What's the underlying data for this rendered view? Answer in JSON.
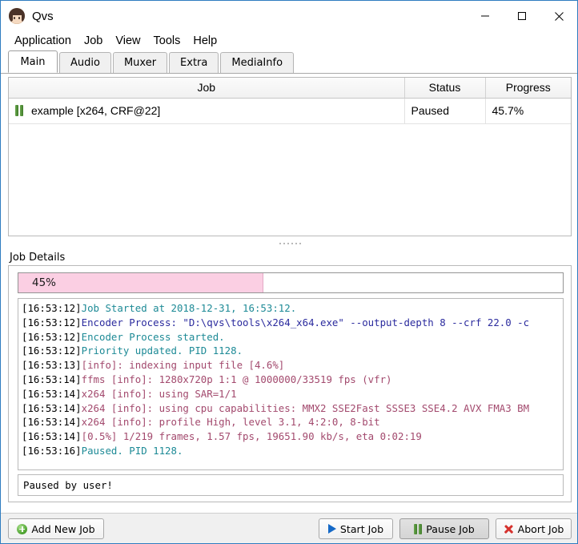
{
  "window": {
    "title": "Qvs",
    "icon": "app-avatar-icon",
    "controls": [
      {
        "name": "minimize",
        "glyph": "minimize-icon"
      },
      {
        "name": "maximize",
        "glyph": "maximize-icon"
      },
      {
        "name": "close",
        "glyph": "close-icon"
      }
    ]
  },
  "menu": {
    "items": [
      {
        "label": "Application"
      },
      {
        "label": "Job"
      },
      {
        "label": "View"
      },
      {
        "label": "Tools"
      },
      {
        "label": "Help"
      }
    ]
  },
  "tabs": {
    "active": "Main",
    "items": [
      {
        "label": "Main"
      },
      {
        "label": "Audio"
      },
      {
        "label": "Muxer"
      },
      {
        "label": "Extra"
      },
      {
        "label": "MediaInfo"
      }
    ]
  },
  "jobs_table": {
    "columns": [
      "Job",
      "Status",
      "Progress"
    ],
    "rows": [
      {
        "icon": "pause-icon",
        "job": "example [x264, CRF@22]",
        "status": "Paused",
        "progress": "45.7%"
      }
    ]
  },
  "details": {
    "group_label": "Job Details",
    "progress": {
      "percent_text": "45%",
      "percent_value": 45,
      "fill_color": "#fbcfe3"
    },
    "log": [
      {
        "time": "[16:53:12]",
        "text": "Job Started at 2018-12-31, 16:53:12.",
        "color": "teal"
      },
      {
        "time": "[16:53:12]",
        "text": "Encoder Process: \"D:\\qvs\\tools\\x264_x64.exe\" --output-depth 8 --crf 22.0 -c",
        "color": "navy"
      },
      {
        "time": "[16:53:12]",
        "text": "Encoder Process started.",
        "color": "teal"
      },
      {
        "time": "[16:53:12]",
        "text": "Priority updated. PID 1128.",
        "color": "teal"
      },
      {
        "time": "[16:53:13]",
        "text": "[info]: indexing input file [4.6%]",
        "color": "rose"
      },
      {
        "time": "[16:53:14]",
        "text": "ffms [info]: 1280x720p 1:1 @ 1000000/33519 fps (vfr)",
        "color": "rose"
      },
      {
        "time": "[16:53:14]",
        "text": "x264 [info]: using SAR=1/1",
        "color": "rose"
      },
      {
        "time": "[16:53:14]",
        "text": "x264 [info]: using cpu capabilities: MMX2 SSE2Fast SSSE3 SSE4.2 AVX FMA3 BM",
        "color": "rose"
      },
      {
        "time": "[16:53:14]",
        "text": "x264 [info]: profile High, level 3.1, 4:2:0, 8-bit",
        "color": "rose"
      },
      {
        "time": "[16:53:14]",
        "text": "[0.5%] 1/219 frames, 1.57 fps, 19651.90 kb/s, eta 0:02:19",
        "color": "rose"
      },
      {
        "time": "[16:53:16]",
        "text": "Paused. PID 1128.",
        "color": "teal"
      }
    ],
    "status_text": "Paused by user!"
  },
  "bottom_buttons": {
    "add": {
      "label": "Add New Job",
      "icon": "add-circle-icon"
    },
    "start": {
      "label": "Start Job",
      "icon": "play-icon"
    },
    "pause": {
      "label": "Pause Job",
      "icon": "pause-icon",
      "pressed": true
    },
    "abort": {
      "label": "Abort Job",
      "icon": "cancel-x-icon"
    }
  }
}
